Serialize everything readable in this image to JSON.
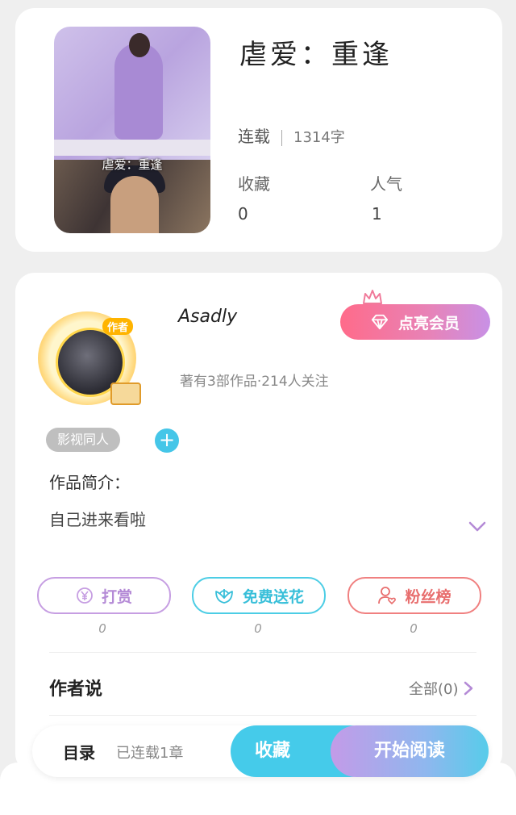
{
  "book": {
    "title": "虐爱：重逢",
    "cover_text": "虐爱：重逢",
    "status": "连载",
    "word_count": "1314字",
    "favorites_label": "收藏",
    "favorites_value": "0",
    "popularity_label": "人气",
    "popularity_value": "1"
  },
  "author": {
    "name": "Asadly",
    "badge": "作者",
    "works_info": "著有3部作品·214人关注",
    "vip_label": "点亮会员",
    "tag": "影视同人",
    "tag_add": "+",
    "intro_label": "作品简介：",
    "intro_text": "自己进来看啦"
  },
  "actions": {
    "reward_label": "打赏",
    "reward_count": "0",
    "flower_label": "免费送花",
    "flower_count": "0",
    "fans_label": "粉丝榜",
    "fans_count": "0"
  },
  "author_says": {
    "label": "作者说",
    "see_all": "全部(0)"
  },
  "bottom_bar": {
    "toc": "目录",
    "toc_info": "已连载1章",
    "collect": "收藏",
    "read": "开始阅读"
  },
  "colors": {
    "accent_cyan": "#45cbea",
    "accent_purple": "#c69ee2",
    "accent_red": "#f08080"
  }
}
